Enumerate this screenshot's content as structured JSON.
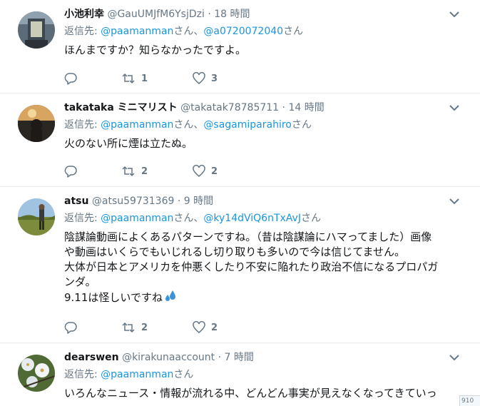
{
  "tweets": [
    {
      "name": "小池利幸",
      "handle": "@GauUMJfM6YsjDzi",
      "dot": " · ",
      "time": "18 時間",
      "reply_prefix": "返信先: ",
      "reply_users": [
        "@paamanman",
        "@a0720072040"
      ],
      "san": "さん",
      "sep": "、",
      "text_lines": [
        "ほんまですか？知らなかったですよ。"
      ],
      "counts": {
        "reply": "",
        "retweet": "1",
        "like": "3"
      }
    },
    {
      "name": "takataka ミニマリスト",
      "handle": "@takatak78785711",
      "dot": " · ",
      "time": "14 時間",
      "reply_prefix": "返信先: ",
      "reply_users": [
        "@paamanman",
        "@sagamiparahiro"
      ],
      "san": "さん",
      "sep": "、",
      "text_lines": [
        "火のない所に煙は立たぬ。"
      ],
      "counts": {
        "reply": "",
        "retweet": "2",
        "like": "2"
      }
    },
    {
      "name": "atsu",
      "handle": "@atsu59731369",
      "dot": " · ",
      "time": "9 時間",
      "reply_prefix": "返信先: ",
      "reply_users": [
        "@paamanman",
        "@ky14dViQ6nTxAvJ"
      ],
      "san": "さん",
      "sep": "、",
      "text_lines": [
        "陰謀論動画によくあるパターンですね。（昔は陰謀論にハマってました）画像",
        "や動画はいくらでもいじれるし切り取りも多いので今は信じてません。",
        "大体が日本とアメリカを仲悪くしたり不安に陥れたり政治不信になるプロパガ",
        "ンダ。",
        "9.11は怪しいですね"
      ],
      "emoji_icon": "droplets-icon",
      "counts": {
        "reply": "",
        "retweet": "2",
        "like": "2"
      }
    },
    {
      "name": "dearswen",
      "handle": "@kirakunaaccount",
      "dot": " · ",
      "time": "7 時間",
      "reply_prefix": "返信先: ",
      "reply_users": [
        "@paamanman"
      ],
      "san": "さん",
      "sep": "、",
      "text_lines": [
        "いろんなニュース・情報が流れる中、どんどん事実が見えなくなってきていっ"
      ],
      "counts": {
        "reply": "",
        "retweet": "",
        "like": ""
      }
    }
  ],
  "icons": {
    "reply": "reply-bubble-icon",
    "retweet": "retweet-icon",
    "like": "heart-icon",
    "more": "chevron-down-icon"
  },
  "colors": {
    "link": "#1b95e0",
    "secondary": "#657786",
    "divider": "#e6ecf0",
    "text": "#14171a"
  },
  "corner_chip": "910"
}
